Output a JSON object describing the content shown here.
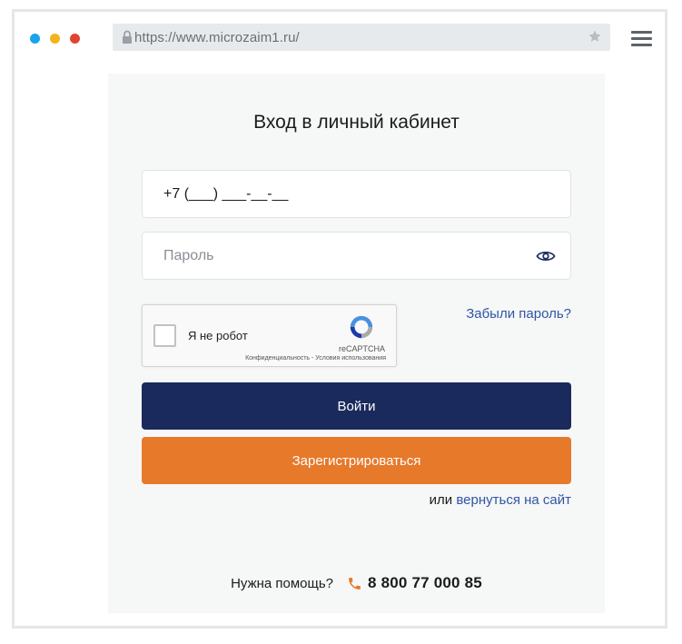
{
  "window": {
    "dots": [
      {
        "name": "blue",
        "color": "#1aa3ec"
      },
      {
        "name": "yellow",
        "color": "#f5b21b"
      },
      {
        "name": "red",
        "color": "#e0442f"
      }
    ],
    "url": "https://www.microzaim1.ru/",
    "icons": {
      "lock": "lock-icon",
      "star": "star-icon",
      "menu": "hamburger-menu-icon"
    }
  },
  "login": {
    "title": "Вход в личный кабинет",
    "phone": {
      "value": "+7 (___) ___-__-__"
    },
    "password": {
      "placeholder": "Пароль",
      "icon": "eye-icon"
    },
    "captcha": {
      "label": "Я не робот",
      "brand": "reCAPTCHA",
      "links": "Конфиденциальность - Условия использования"
    },
    "forgot_link": "Забыли пароль?",
    "login_button": "Войти",
    "register_button": "Зарегистрироваться",
    "back": {
      "prefix": "или",
      "link": "вернуться на сайт"
    },
    "help": {
      "text": "Нужна помощь?",
      "phone": "8 800 77 000 85",
      "icon": "phone-icon"
    }
  },
  "colors": {
    "primary": "#1a2a5c",
    "accent": "#e7792b",
    "link": "#2f55a5"
  }
}
